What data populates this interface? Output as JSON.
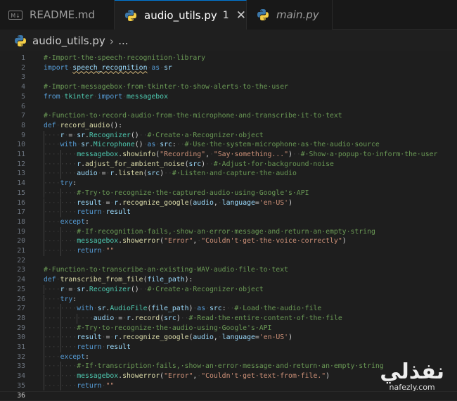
{
  "tabs": [
    {
      "label": "README.md",
      "icon": "markdown-icon",
      "icon_text": "M↓",
      "active": false,
      "italic": false
    },
    {
      "label": "audio_utils.py",
      "icon": "python-icon",
      "active": true,
      "italic": false,
      "problems": "1",
      "close": "✕"
    },
    {
      "label": "main.py",
      "icon": "python-icon",
      "active": false,
      "italic": true
    }
  ],
  "breadcrumb": {
    "file": "audio_utils.py",
    "sep": "›",
    "rest": "..."
  },
  "editor": {
    "current_line": 36,
    "lines": [
      {
        "n": "1",
        "tokens": [
          [
            "c",
            "#·Import·the·speech·recognition·library"
          ]
        ]
      },
      {
        "n": "2",
        "tokens": [
          [
            "k",
            "import"
          ],
          [
            "ws",
            "·"
          ],
          [
            "v ul",
            "speech_recognition"
          ],
          [
            "ws",
            "·"
          ],
          [
            "k",
            "as"
          ],
          [
            "ws",
            "·"
          ],
          [
            "v",
            "sr"
          ]
        ]
      },
      {
        "n": "3",
        "tokens": []
      },
      {
        "n": "4",
        "tokens": [
          [
            "c",
            "#·Import·messagebox·from·tkinter·to·show·alerts·to·the·user"
          ]
        ]
      },
      {
        "n": "5",
        "tokens": [
          [
            "k",
            "from"
          ],
          [
            "ws",
            "·"
          ],
          [
            "cl",
            "tkinter"
          ],
          [
            "ws",
            "·"
          ],
          [
            "k",
            "import"
          ],
          [
            "ws",
            "·"
          ],
          [
            "cl",
            "messagebox"
          ]
        ]
      },
      {
        "n": "6",
        "tokens": []
      },
      {
        "n": "7",
        "tokens": [
          [
            "c",
            "#·Function·to·record·audio·from·the·microphone·and·transcribe·it·to·text"
          ]
        ]
      },
      {
        "n": "8",
        "tokens": [
          [
            "k",
            "def"
          ],
          [
            "ws",
            "·"
          ],
          [
            "f",
            "record_audio"
          ],
          [
            "o",
            "():"
          ]
        ]
      },
      {
        "n": "9",
        "tokens": [
          [
            "ws",
            "····"
          ],
          [
            "v",
            "r"
          ],
          [
            "ws",
            "·"
          ],
          [
            "o",
            "="
          ],
          [
            "ws",
            "·"
          ],
          [
            "v",
            "sr"
          ],
          [
            "o",
            "."
          ],
          [
            "cl",
            "Recognizer"
          ],
          [
            "o",
            "()"
          ],
          [
            "ws",
            "··"
          ],
          [
            "c",
            "#·Create·a·Recognizer·object"
          ]
        ]
      },
      {
        "n": "10",
        "tokens": [
          [
            "ws",
            "····"
          ],
          [
            "k",
            "with"
          ],
          [
            "ws",
            "·"
          ],
          [
            "v",
            "sr"
          ],
          [
            "o",
            "."
          ],
          [
            "cl",
            "Microphone"
          ],
          [
            "o",
            "()"
          ],
          [
            "ws",
            "·"
          ],
          [
            "k",
            "as"
          ],
          [
            "ws",
            "·"
          ],
          [
            "v",
            "src"
          ],
          [
            "o",
            ":"
          ],
          [
            "ws",
            "··"
          ],
          [
            "c",
            "#·Use·the·system·microphone·as·the·audio·source"
          ]
        ]
      },
      {
        "n": "11",
        "tokens": [
          [
            "ws",
            "········"
          ],
          [
            "cl",
            "messagebox"
          ],
          [
            "o",
            "."
          ],
          [
            "f",
            "showinfo"
          ],
          [
            "o",
            "("
          ],
          [
            "s",
            "\"Recording\""
          ],
          [
            "o",
            ","
          ],
          [
            "ws",
            "·"
          ],
          [
            "s",
            "\"Say·something...\""
          ],
          [
            "o",
            ")"
          ],
          [
            "ws",
            "··"
          ],
          [
            "c",
            "#·Show·a·popup·to·inform·the·user"
          ]
        ]
      },
      {
        "n": "12",
        "tokens": [
          [
            "ws",
            "········"
          ],
          [
            "v",
            "r"
          ],
          [
            "o",
            "."
          ],
          [
            "f",
            "adjust_for_ambient_noise"
          ],
          [
            "o",
            "("
          ],
          [
            "v",
            "src"
          ],
          [
            "o",
            ")"
          ],
          [
            "ws",
            "··"
          ],
          [
            "c",
            "#·Adjust·for·background·noise"
          ]
        ]
      },
      {
        "n": "13",
        "tokens": [
          [
            "ws",
            "········"
          ],
          [
            "v",
            "audio"
          ],
          [
            "ws",
            "·"
          ],
          [
            "o",
            "="
          ],
          [
            "ws",
            "·"
          ],
          [
            "v",
            "r"
          ],
          [
            "o",
            "."
          ],
          [
            "f",
            "listen"
          ],
          [
            "o",
            "("
          ],
          [
            "v",
            "src"
          ],
          [
            "o",
            ")"
          ],
          [
            "ws",
            "··"
          ],
          [
            "c",
            "#·Listen·and·capture·the·audio"
          ]
        ]
      },
      {
        "n": "14",
        "tokens": [
          [
            "ws",
            "····"
          ],
          [
            "k",
            "try"
          ],
          [
            "o",
            ":"
          ]
        ]
      },
      {
        "n": "15",
        "tokens": [
          [
            "ws",
            "········"
          ],
          [
            "c",
            "#·Try·to·recognize·the·captured·audio·using·Google's·API"
          ]
        ]
      },
      {
        "n": "16",
        "tokens": [
          [
            "ws",
            "········"
          ],
          [
            "v",
            "result"
          ],
          [
            "ws",
            "·"
          ],
          [
            "o",
            "="
          ],
          [
            "ws",
            "·"
          ],
          [
            "v",
            "r"
          ],
          [
            "o",
            "."
          ],
          [
            "f",
            "recognize_google"
          ],
          [
            "o",
            "("
          ],
          [
            "v",
            "audio"
          ],
          [
            "o",
            ","
          ],
          [
            "ws",
            "·"
          ],
          [
            "v",
            "language"
          ],
          [
            "o",
            "="
          ],
          [
            "s",
            "'en-US'"
          ],
          [
            "o",
            ")"
          ]
        ]
      },
      {
        "n": "17",
        "tokens": [
          [
            "ws",
            "········"
          ],
          [
            "k",
            "return"
          ],
          [
            "ws",
            "·"
          ],
          [
            "v",
            "result"
          ]
        ]
      },
      {
        "n": "18",
        "tokens": [
          [
            "ws",
            "····"
          ],
          [
            "k",
            "except"
          ],
          [
            "o",
            ":"
          ]
        ]
      },
      {
        "n": "19",
        "tokens": [
          [
            "ws",
            "········"
          ],
          [
            "c",
            "#·If·recognition·fails,·show·an·error·message·and·return·an·empty·string"
          ]
        ]
      },
      {
        "n": "20",
        "tokens": [
          [
            "ws",
            "········"
          ],
          [
            "cl",
            "messagebox"
          ],
          [
            "o",
            "."
          ],
          [
            "f",
            "showerror"
          ],
          [
            "o",
            "("
          ],
          [
            "s",
            "\"Error\""
          ],
          [
            "o",
            ","
          ],
          [
            "ws",
            "·"
          ],
          [
            "s",
            "\"Couldn't·get·the·voice·correctly\""
          ],
          [
            "o",
            ")"
          ]
        ]
      },
      {
        "n": "21",
        "tokens": [
          [
            "ws",
            "········"
          ],
          [
            "k",
            "return"
          ],
          [
            "ws",
            "·"
          ],
          [
            "s",
            "\"\""
          ]
        ]
      },
      {
        "n": "22",
        "tokens": []
      },
      {
        "n": "23",
        "tokens": [
          [
            "c",
            "#·Function·to·transcribe·an·existing·WAV·audio·file·to·text"
          ]
        ]
      },
      {
        "n": "24",
        "tokens": [
          [
            "k",
            "def"
          ],
          [
            "ws",
            "·"
          ],
          [
            "f",
            "transcribe_from_file"
          ],
          [
            "o",
            "("
          ],
          [
            "v",
            "file_path"
          ],
          [
            "o",
            "):"
          ]
        ]
      },
      {
        "n": "25",
        "tokens": [
          [
            "ws",
            "····"
          ],
          [
            "v",
            "r"
          ],
          [
            "ws",
            "·"
          ],
          [
            "o",
            "="
          ],
          [
            "ws",
            "·"
          ],
          [
            "v",
            "sr"
          ],
          [
            "o",
            "."
          ],
          [
            "cl",
            "Recognizer"
          ],
          [
            "o",
            "()"
          ],
          [
            "ws",
            "··"
          ],
          [
            "c",
            "#·Create·a·Recognizer·object"
          ]
        ]
      },
      {
        "n": "26",
        "tokens": [
          [
            "ws",
            "····"
          ],
          [
            "k",
            "try"
          ],
          [
            "o",
            ":"
          ]
        ]
      },
      {
        "n": "27",
        "tokens": [
          [
            "ws",
            "········"
          ],
          [
            "k",
            "with"
          ],
          [
            "ws",
            "·"
          ],
          [
            "v",
            "sr"
          ],
          [
            "o",
            "."
          ],
          [
            "cl",
            "AudioFile"
          ],
          [
            "o",
            "("
          ],
          [
            "v",
            "file_path"
          ],
          [
            "o",
            ")"
          ],
          [
            "ws",
            "·"
          ],
          [
            "k",
            "as"
          ],
          [
            "ws",
            "·"
          ],
          [
            "v",
            "src"
          ],
          [
            "o",
            ":"
          ],
          [
            "ws",
            "··"
          ],
          [
            "c",
            "#·Load·the·audio·file"
          ]
        ]
      },
      {
        "n": "28",
        "tokens": [
          [
            "ws",
            "············"
          ],
          [
            "v",
            "audio"
          ],
          [
            "ws",
            "·"
          ],
          [
            "o",
            "="
          ],
          [
            "ws",
            "·"
          ],
          [
            "v",
            "r"
          ],
          [
            "o",
            "."
          ],
          [
            "f",
            "record"
          ],
          [
            "o",
            "("
          ],
          [
            "v",
            "src"
          ],
          [
            "o",
            ")"
          ],
          [
            "ws",
            "··"
          ],
          [
            "c",
            "#·Read·the·entire·content·of·the·file"
          ]
        ]
      },
      {
        "n": "29",
        "tokens": [
          [
            "ws",
            "········"
          ],
          [
            "c",
            "#·Try·to·recognize·the·audio·using·Google's·API"
          ]
        ]
      },
      {
        "n": "30",
        "tokens": [
          [
            "ws",
            "········"
          ],
          [
            "v",
            "result"
          ],
          [
            "ws",
            "·"
          ],
          [
            "o",
            "="
          ],
          [
            "ws",
            "·"
          ],
          [
            "v",
            "r"
          ],
          [
            "o",
            "."
          ],
          [
            "f",
            "recognize_google"
          ],
          [
            "o",
            "("
          ],
          [
            "v",
            "audio"
          ],
          [
            "o",
            ","
          ],
          [
            "ws",
            "·"
          ],
          [
            "v",
            "language"
          ],
          [
            "o",
            "="
          ],
          [
            "s",
            "'en-US'"
          ],
          [
            "o",
            ")"
          ]
        ]
      },
      {
        "n": "31",
        "tokens": [
          [
            "ws",
            "········"
          ],
          [
            "k",
            "return"
          ],
          [
            "ws",
            "·"
          ],
          [
            "v",
            "result"
          ]
        ]
      },
      {
        "n": "32",
        "tokens": [
          [
            "ws",
            "····"
          ],
          [
            "k",
            "except"
          ],
          [
            "o",
            ":"
          ]
        ]
      },
      {
        "n": "33",
        "tokens": [
          [
            "ws",
            "········"
          ],
          [
            "c",
            "#·If·transcription·fails,·show·an·error·message·and·return·an·empty·string"
          ]
        ]
      },
      {
        "n": "34",
        "tokens": [
          [
            "ws",
            "········"
          ],
          [
            "cl",
            "messagebox"
          ],
          [
            "o",
            "."
          ],
          [
            "f",
            "showerror"
          ],
          [
            "o",
            "("
          ],
          [
            "s",
            "\"Error\""
          ],
          [
            "o",
            ","
          ],
          [
            "ws",
            "·"
          ],
          [
            "s",
            "\"Couldn't·get·text·from·file.\""
          ],
          [
            "o",
            ")"
          ]
        ]
      },
      {
        "n": "35",
        "tokens": [
          [
            "ws",
            "········"
          ],
          [
            "k",
            "return"
          ],
          [
            "ws",
            "·"
          ],
          [
            "s",
            "\"\""
          ]
        ]
      },
      {
        "n": "36",
        "tokens": []
      }
    ]
  },
  "watermark": {
    "arabic": "نفذلي",
    "url": "nafezly.com"
  }
}
